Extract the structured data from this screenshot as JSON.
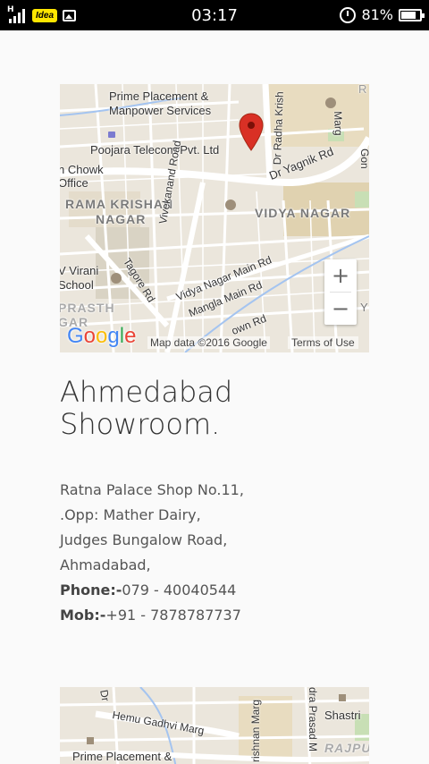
{
  "status_bar": {
    "carrier": "Idea",
    "network": "H",
    "time": "03:17",
    "battery": "81%",
    "battery_level": 0.81
  },
  "map1": {
    "labels": {
      "prime_placement": "Prime Placement &",
      "manpower": "Manpower Services",
      "poojara": "Poojara Telecom Pvt. Ltd",
      "n_chowk": "n Chowk",
      "office": "Office",
      "rama_krishan": "RAMA KRISHAN",
      "nagar": "NAGAR",
      "vidya_nagar": "VIDYA NAGAR",
      "vivekanand": "Vivekanand Road",
      "dr_yagnik": "Dr Yagnik Rd",
      "dr_radha": "Dr Radha Krish",
      "marg": "Marg",
      "r": "R",
      "gon": "Gon",
      "v_virani": "V Virani",
      "school": "School",
      "tagore": "Tagore Rd",
      "vidya_main": "Vidya Nagar Main Rd",
      "mangla": "Mangla Main Rd",
      "prasth": "PRASTH",
      "gar": "GAR",
      "town_rd": "own Rd",
      "y": "Y"
    },
    "zoom_in": "+",
    "zoom_out": "−",
    "google": [
      "G",
      "o",
      "o",
      "g",
      "l",
      "e"
    ],
    "map_data": "Map data ©2016 Google",
    "terms": "Terms of Use"
  },
  "showroom": {
    "title_line1": "Ahmedabad",
    "title_line2": "Showroom.",
    "address_lines": [
      "Ratna Palace Shop No.11,",
      ".Opp: Mather Dairy,",
      "Judges Bungalow Road,",
      "Ahmadabad,"
    ],
    "phone_label": "Phone:-",
    "phone": "079 - 40040544",
    "mob_label": "Mob:-",
    "mob": "+91 - 7878787737"
  },
  "map2": {
    "labels": {
      "dr": "Dr",
      "hemu": "Hemu Gadhvi Marg",
      "krishnan": "rishnan Marg",
      "prasad": "dra Prasad M",
      "shastri": "Shastri",
      "rajpu": "RAJPU",
      "prime": "Prime Placement &"
    }
  },
  "colors": {
    "google_blue": "#4285F4",
    "google_red": "#EA4335",
    "google_yellow": "#FBBC05",
    "google_green": "#34A853",
    "marker": "#d93025"
  }
}
